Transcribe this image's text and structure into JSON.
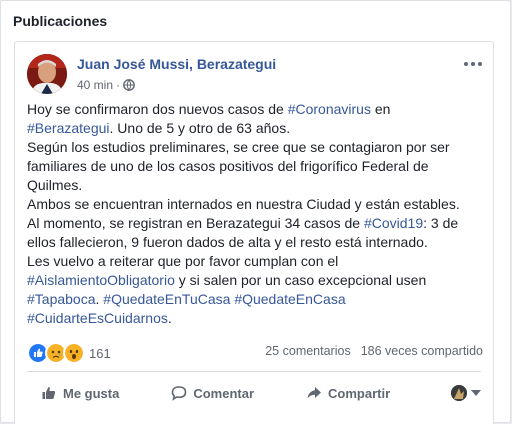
{
  "section": {
    "title": "Publicaciones"
  },
  "post": {
    "author": "Juan José Mussi, Berazategui",
    "time": "40 min",
    "separator": "·",
    "lines": [
      [
        {
          "t": "Hoy se confirmaron dos nuevos casos de "
        },
        {
          "t": "#Coronavirus",
          "tag": true
        },
        {
          "t": " en"
        }
      ],
      [
        {
          "t": "#Berazategui",
          "tag": true
        },
        {
          "t": ". Uno de 5 y otro de 63 años."
        }
      ],
      [
        {
          "t": "Según los estudios preliminares, se cree que se contagiaron por ser"
        }
      ],
      [
        {
          "t": "familiares de uno de los casos positivos del frigorífico Federal de"
        }
      ],
      [
        {
          "t": "Quilmes."
        }
      ],
      [
        {
          "t": "Ambos se encuentran internados en nuestra Ciudad y están estables."
        }
      ],
      [
        {
          "t": "Al momento, se registran en Berazategui 34 casos de "
        },
        {
          "t": "#Covid19",
          "tag": true
        },
        {
          "t": ": 3 de"
        }
      ],
      [
        {
          "t": "ellos fallecieron, 9 fueron dados de alta y el resto está internado."
        }
      ],
      [
        {
          "t": "Les vuelvo a reiterar que por favor cumplan con el"
        }
      ],
      [
        {
          "t": "#AislamientoObligatorio",
          "tag": true
        },
        {
          "t": " y si salen por un caso excepcional usen"
        }
      ],
      [
        {
          "t": "#Tapaboca",
          "tag": true
        },
        {
          "t": ". "
        },
        {
          "t": "#QuedateEnTuCasa",
          "tag": true
        },
        {
          "t": " "
        },
        {
          "t": "#QuedateEnCasa",
          "tag": true
        }
      ],
      [
        {
          "t": "#CuidarteEsCuidarnos",
          "tag": true
        },
        {
          "t": "."
        }
      ]
    ],
    "reactions": {
      "count": "161",
      "types": [
        "like",
        "sad",
        "wow"
      ],
      "colors": {
        "like": "#2078f4",
        "sad": "#f7b125",
        "wow": "#f7b125"
      }
    },
    "comments": "25 comentarios",
    "shares": "186 veces compartido",
    "actions": {
      "like": "Me gusta",
      "comment": "Comentar",
      "share": "Compartir"
    },
    "colors": {
      "link": "#365899",
      "text": "#1d2129",
      "muted": "#606770"
    }
  }
}
